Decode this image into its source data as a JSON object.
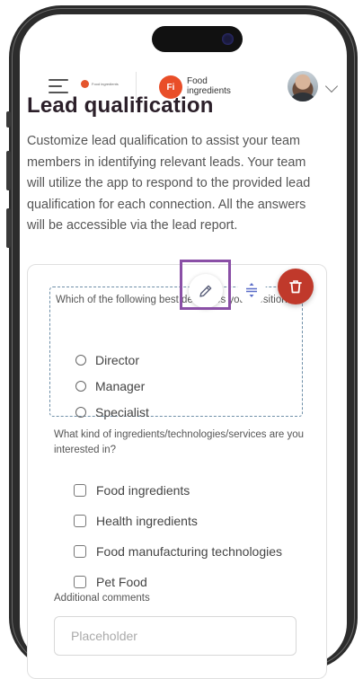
{
  "header": {
    "small_logo_text": "Food ingredients",
    "badge": "Fi",
    "brand_line1": "Food",
    "brand_line2": "ingredients"
  },
  "page": {
    "title": "Lead qualification",
    "description": "Customize lead qualification to assist your team members in identifying relevant leads. Your team will utilize the app to respond to the provided lead qualification for each connection. All the answers will be accessible via the lead report."
  },
  "question1": {
    "text": "Which of the following best describes your position?",
    "options": [
      "Director",
      "Manager",
      "Specialist"
    ]
  },
  "question2": {
    "text": "What kind of ingredients/technologies/services are you interested in?",
    "options": [
      "Food ingredients",
      "Health ingredients",
      "Food manufacturing technologies",
      "Pet Food"
    ]
  },
  "comments": {
    "label": "Additional comments",
    "placeholder": "Placeholder"
  },
  "icons": {
    "edit": "pencil-icon",
    "drag": "drag-handle-icon",
    "delete": "trash-icon",
    "menu": "hamburger-icon",
    "dropdown": "chevron-down-icon"
  },
  "colors": {
    "accent_highlight": "#8a4fa6",
    "delete": "#c0392b",
    "brand_orange": "#e94e28",
    "title": "#2b1f29"
  }
}
